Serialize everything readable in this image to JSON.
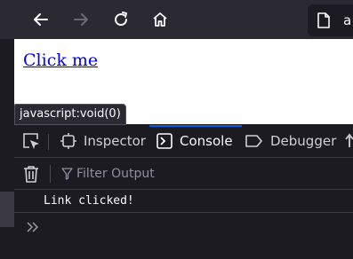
{
  "toolbar": {
    "back_icon": "back-arrow-icon",
    "forward_icon": "forward-arrow-icon",
    "reload_icon": "reload-icon",
    "home_icon": "home-icon",
    "url_text": "a"
  },
  "page": {
    "link_text": "Click me"
  },
  "status_bar": {
    "text": "javascript:void(0)"
  },
  "devtools": {
    "tabs": [
      {
        "label": "Inspector",
        "icon": "inspector-icon",
        "active": false
      },
      {
        "label": "Console",
        "icon": "console-icon",
        "active": true
      },
      {
        "label": "Debugger",
        "icon": "debugger-icon",
        "active": false
      }
    ],
    "filter": {
      "placeholder": "Filter Output"
    },
    "messages": [
      {
        "text": "Link clicked!"
      }
    ],
    "accent_color": "#0060df"
  }
}
